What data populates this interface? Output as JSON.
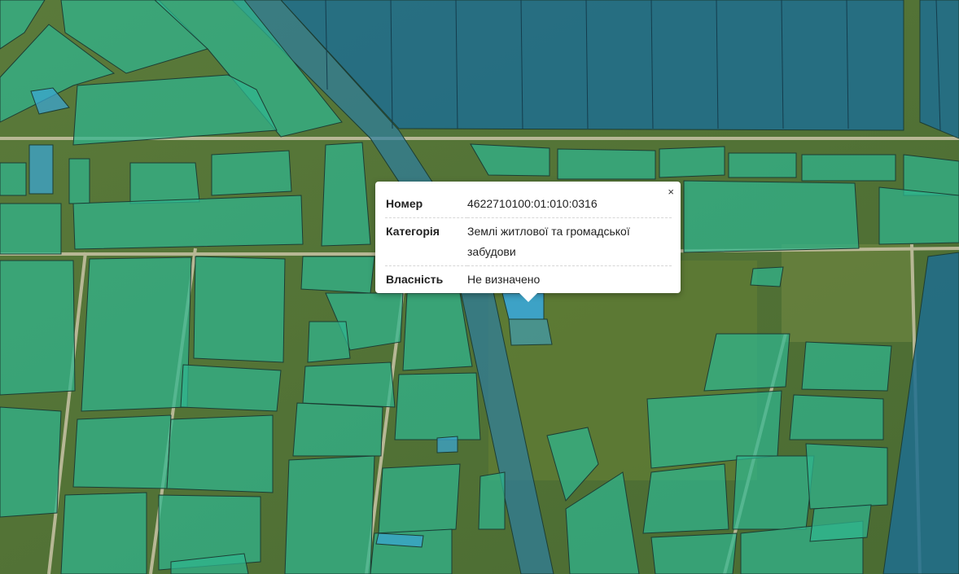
{
  "popup": {
    "close_label": "×",
    "rows": [
      {
        "label": "Номер",
        "value": "4622710100:01:010:0316"
      },
      {
        "label": "Категорія",
        "value": "Землі житлової та громадської забудови"
      },
      {
        "label": "Власність",
        "value": "Не визначено"
      }
    ]
  },
  "colors": {
    "parcel_fill": "#2fb58f",
    "parcel_stroke": "#1c3d33",
    "water_fill": "#1f6d8e",
    "highlight_fill": "#3aa6d6",
    "road": "#c9c3a6"
  }
}
